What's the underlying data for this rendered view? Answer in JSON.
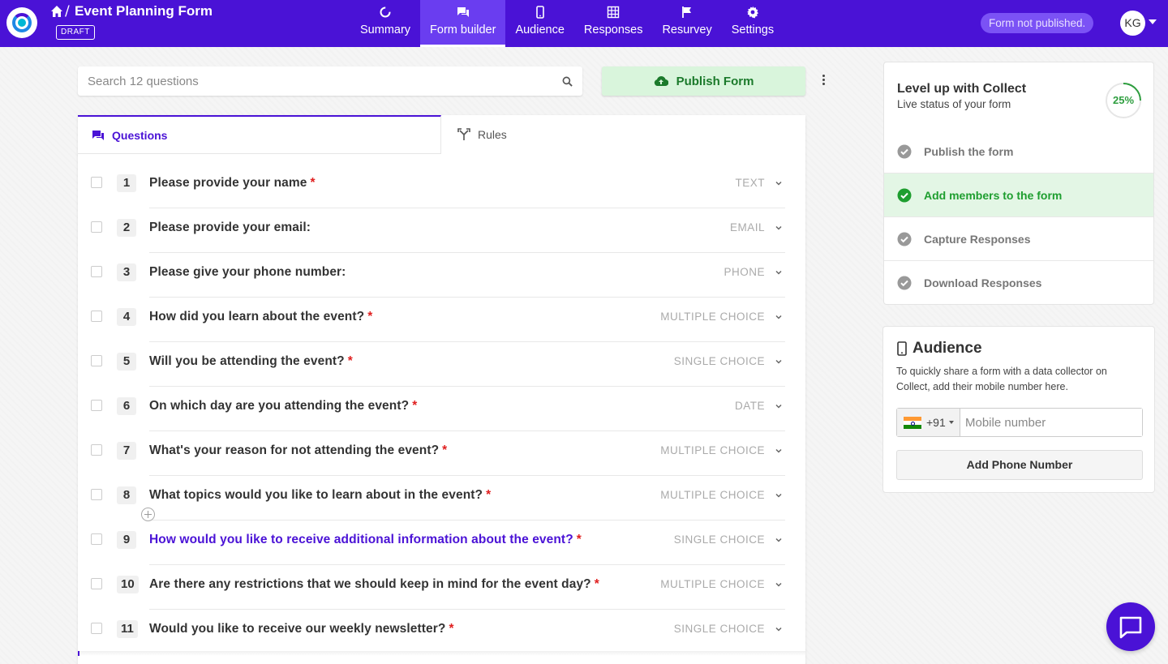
{
  "header": {
    "form_title": "Event Planning Form",
    "crumb_separator": "/",
    "draft_label": "DRAFT",
    "status": "Form not published.",
    "avatar_initials": "KG"
  },
  "nav": [
    {
      "label": "Summary",
      "icon": "summary-icon"
    },
    {
      "label": "Form builder",
      "icon": "form-builder-icon",
      "active": true
    },
    {
      "label": "Audience",
      "icon": "mobile-icon"
    },
    {
      "label": "Responses",
      "icon": "grid-icon"
    },
    {
      "label": "Resurvey",
      "icon": "flag-icon"
    },
    {
      "label": "Settings",
      "icon": "gear-icon"
    }
  ],
  "toolbar": {
    "search_placeholder": "Search 12 questions",
    "publish_label": "Publish Form"
  },
  "tabs": {
    "questions": "Questions",
    "rules": "Rules"
  },
  "questions": [
    {
      "num": "1",
      "text": "Please provide your name",
      "required": true,
      "type": "TEXT"
    },
    {
      "num": "2",
      "text": "Please provide your email:",
      "required": false,
      "type": "EMAIL"
    },
    {
      "num": "3",
      "text": "Please give your phone number:",
      "required": false,
      "type": "PHONE"
    },
    {
      "num": "4",
      "text": "How did you learn about the event?",
      "required": true,
      "type": "MULTIPLE CHOICE"
    },
    {
      "num": "5",
      "text": "Will you be attending the event?",
      "required": true,
      "type": "SINGLE CHOICE"
    },
    {
      "num": "6",
      "text": "On which day are you attending the event?",
      "required": true,
      "type": "DATE"
    },
    {
      "num": "7",
      "text": "What's your reason for not attending the event?",
      "required": true,
      "type": "MULTIPLE CHOICE"
    },
    {
      "num": "8",
      "text": "What topics would you like to learn about in the event?",
      "required": true,
      "type": "MULTIPLE CHOICE"
    },
    {
      "num": "9",
      "text": "How would you like to receive additional information about the event?",
      "required": true,
      "type": "SINGLE CHOICE",
      "highlight": true
    },
    {
      "num": "10",
      "text": "Are there any restrictions that we should keep in mind for the event day?",
      "required": true,
      "type": "MULTIPLE CHOICE"
    },
    {
      "num": "11",
      "text": "Would you like to receive our weekly newsletter?",
      "required": true,
      "type": "SINGLE CHOICE"
    }
  ],
  "required_mark": "*",
  "levelup": {
    "title": "Level up with Collect",
    "subtitle": "Live status of your form",
    "progress_text": "25%",
    "progress_fraction": 0.25,
    "items": [
      {
        "label": "Publish the form",
        "done": false
      },
      {
        "label": "Add members to the form",
        "done": true
      },
      {
        "label": "Capture Responses",
        "done": false
      },
      {
        "label": "Download Responses",
        "done": false
      }
    ]
  },
  "audience": {
    "title": "Audience",
    "description": "To quickly share a form with a data collector on Collect, add their mobile number here.",
    "country_code": "+91",
    "phone_placeholder": "Mobile number",
    "add_button": "Add Phone Number"
  },
  "colors": {
    "brand": "#4a12d6",
    "success": "#1e9e2f",
    "required": "#e02020"
  }
}
